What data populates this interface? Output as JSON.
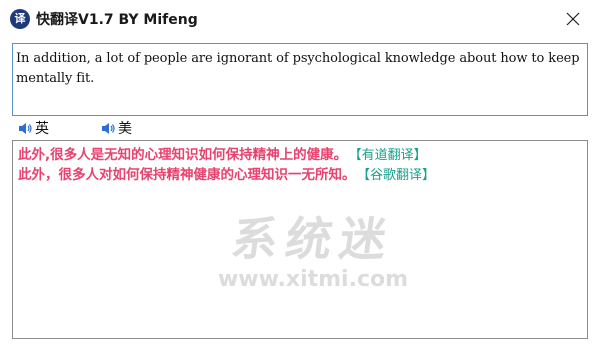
{
  "window": {
    "title": "快翻译V1.7 BY Mifeng",
    "app_icon_glyph": "译",
    "close_icon": "close-icon"
  },
  "source": {
    "text": "In addition, a lot of people are ignorant of psychological knowledge about how to keep mentally fit."
  },
  "speak": {
    "uk_label": "英",
    "us_label": "美",
    "icon": "speaker-icon"
  },
  "results": [
    {
      "text": "此外,很多人是无知的心理知识如何保持精神上的健康。",
      "source": "【有道翻译】"
    },
    {
      "text": "此外，很多人对如何保持精神健康的心理知识一无所知。",
      "source": "【谷歌翻译】"
    }
  ],
  "watermark": {
    "cn": "系统迷",
    "url": "www.xitmi.com"
  },
  "colors": {
    "result_text": "#e8426f",
    "source_tag": "#1aa08c",
    "input_border": "#5a8fd6",
    "watermark": "#dcdcdc"
  }
}
